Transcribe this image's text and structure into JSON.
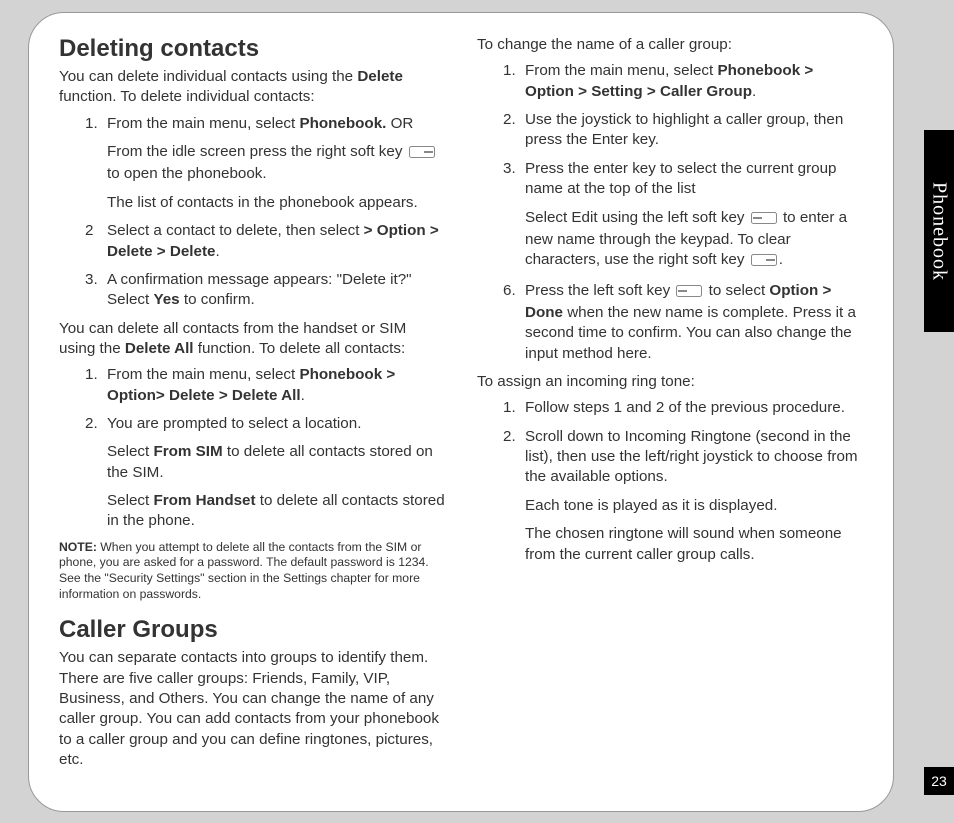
{
  "sideTab": "Phonebook",
  "pageNumber": "23",
  "sec1": {
    "heading": "Deleting contacts",
    "intro_a": "You can delete individual contacts using the ",
    "intro_b": "Delete",
    "intro_c": " function. To delete individual contacts:",
    "list1": {
      "i1": {
        "num": "1.",
        "a": "From the main menu, select ",
        "b": "Phonebook.",
        "c": " OR",
        "p2a": "From the idle screen press the right soft key ",
        "p2b": " to open the phonebook.",
        "p3": "The list of contacts in the phonebook appears."
      },
      "i2": {
        "num": "2",
        "a": "Select a contact to delete, then select ",
        "b": "> Option > Delete > Delete",
        "c": "."
      },
      "i3": {
        "num": "3.",
        "a": "A confirmation message appears: \"Delete it?\" Select ",
        "b": "Yes",
        "c": " to confirm."
      }
    },
    "mid_a": "You can delete all contacts from the handset or SIM using the ",
    "mid_b": "Delete All",
    "mid_c": " function. To delete all contacts:",
    "list2": {
      "i1": {
        "num": "1.",
        "a": "From the main menu, select ",
        "b": "Phonebook > Option> Delete > Delete All",
        "c": "."
      },
      "i2": {
        "num": "2.",
        "a": "You are prompted to select a location.",
        "p2a": "Select ",
        "p2b": "From SIM",
        "p2c": " to delete all contacts stored on the SIM.",
        "p3a": "Select ",
        "p3b": "From Handset",
        "p3c": " to delete all contacts stored in the phone."
      }
    },
    "note_label": "NOTE:",
    "note_text": " When you attempt to delete all the contacts from the SIM or phone, you are asked for a password.  The default password is 1234. See the \"Security Settings\" section in the Settings chapter for more information on passwords."
  },
  "sec2": {
    "heading": "Caller Groups",
    "p1": "You can separate contacts into groups to identify them. There are five caller groups: Friends, Family, VIP, Business, and Others. You can change the name of any caller group. You can add contacts from your phonebook to a caller group and you can define ringtones, pictures, etc.",
    "p2": "To change the name of a caller group:",
    "list1": {
      "i1": {
        "num": "1.",
        "a": "From the main menu, select ",
        "b": "Phonebook > Option > Setting > Caller Group",
        "c": "."
      },
      "i2": {
        "num": "2.",
        "a": "Use the joystick to highlight a caller group, then press the Enter key."
      },
      "i3": {
        "num": "3.",
        "a": "Press the enter key to select the current group name at the top of the list",
        "p2a": "Select Edit using the left soft key ",
        "p2b": " to enter a new name through the keypad. To clear characters, use the right soft key ",
        "p2c": "."
      },
      "i6": {
        "num": "6.",
        "a": "Press the left soft key ",
        "b": " to select ",
        "c": "Option > Done",
        "d": " when the new name is complete. Press it a second time to confirm. You can also change the input method here."
      }
    },
    "p3": "To assign an incoming ring tone:",
    "list2": {
      "i1": {
        "num": "1.",
        "a": "Follow steps 1 and 2 of the previous procedure."
      },
      "i2": {
        "num": "2.",
        "a": "Scroll down to Incoming Ringtone (second in the list), then use the left/right joystick to choose from the available options.",
        "p2": "Each tone is played as it is displayed.",
        "p3": "The chosen ringtone will sound when someone from the current caller group calls."
      }
    }
  }
}
